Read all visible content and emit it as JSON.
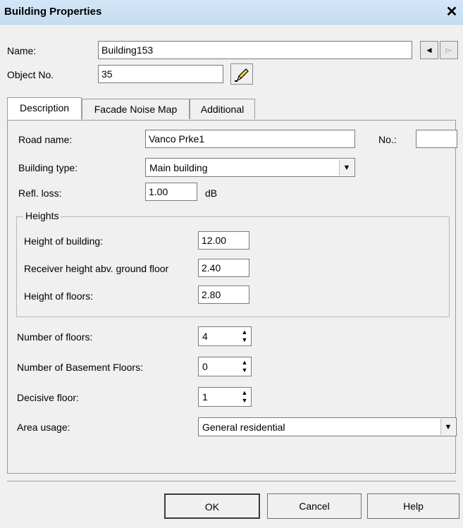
{
  "window": {
    "title": "Building Properties",
    "close_glyph": "✕"
  },
  "header": {
    "name_label": "Name:",
    "name_value": "Building153",
    "object_no_label": "Object No.",
    "object_no_value": "35",
    "nav_prev_glyph": "◄",
    "nav_next_glyph": "▻",
    "edit_icon": "pencil-icon"
  },
  "tabs": [
    {
      "label": "Description",
      "active": true
    },
    {
      "label": "Facade Noise Map",
      "active": false
    },
    {
      "label": "Additional",
      "active": false
    }
  ],
  "description": {
    "road_name_label": "Road name:",
    "road_name_value": "Vanco Prke1",
    "no_label": "No.:",
    "no_value": "",
    "building_type_label": "Building type:",
    "building_type_value": "Main building",
    "refl_loss_label": "Refl. loss:",
    "refl_loss_value": "1.00",
    "refl_loss_unit": "dB",
    "heights": {
      "legend": "Heights",
      "height_of_building_label": "Height of building:",
      "height_of_building_value": "12.00",
      "receiver_height_label": "Receiver height abv. ground floor",
      "receiver_height_value": "2.40",
      "height_of_floors_label": "Height of floors:",
      "height_of_floors_value": "2.80"
    },
    "number_of_floors_label": "Number of floors:",
    "number_of_floors_value": "4",
    "basement_floors_label": "Number of Basement Floors:",
    "basement_floors_value": "0",
    "decisive_floor_label": "Decisive floor:",
    "decisive_floor_value": "1",
    "area_usage_label": "Area usage:",
    "area_usage_value": "General residential"
  },
  "footer": {
    "ok_label": "OK",
    "cancel_label": "Cancel",
    "help_label": "Help"
  },
  "colors": {
    "titlebar": "#c7dcf2",
    "dialog_bg": "#f0f0f0"
  }
}
